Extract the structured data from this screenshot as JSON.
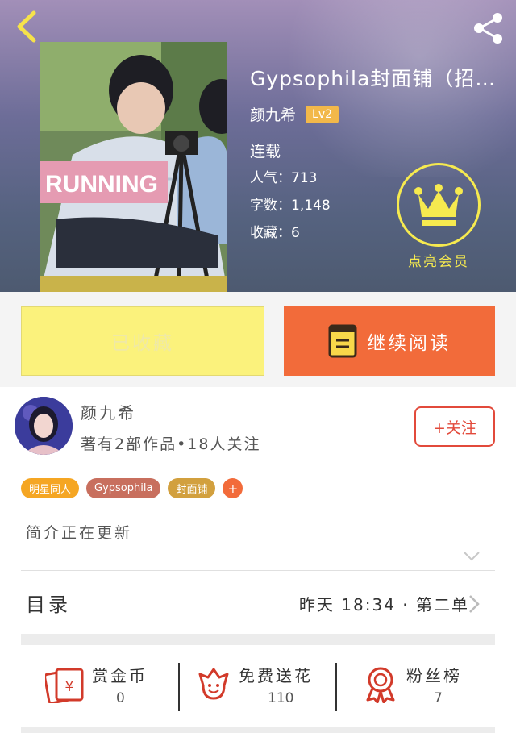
{
  "header": {
    "back_icon": "chevron-left-icon",
    "share_icon": "share-icon",
    "cover_text": "RUNNING",
    "title": "Gypsophila封面铺（招…",
    "author": "颜九希",
    "level": "Lv2",
    "status": "连载",
    "stats": [
      {
        "label": "人气：",
        "value": "713"
      },
      {
        "label": "字数：",
        "value": "1,148"
      },
      {
        "label": "收藏：",
        "value": "6"
      }
    ],
    "vip_icon": "crown-icon",
    "vip_label": "点亮会员"
  },
  "actions": {
    "collect_label": "已收藏",
    "read_label": "继续阅读",
    "read_icon": "book-icon"
  },
  "author_section": {
    "name": "颜九希",
    "works": "著有2部作品•18人关注",
    "follow_label": "+关注"
  },
  "tags": [
    {
      "label": "明星同人",
      "color": "#f5a623"
    },
    {
      "label": "Gypsophila",
      "color": "#c86f5e"
    },
    {
      "label": "封面铺",
      "color": "#d2a03e"
    }
  ],
  "tag_add": "+",
  "intro": "简介正在更新",
  "catalog": {
    "title": "目录",
    "update": "昨天 18:34 · 第二单"
  },
  "bottom": [
    {
      "label": "赏金币",
      "value": "0",
      "icon": "red-envelope-icon"
    },
    {
      "label": "免费送花",
      "value": "110",
      "icon": "flower-icon"
    },
    {
      "label": "粉丝榜",
      "value": "7",
      "icon": "medal-icon"
    }
  ],
  "colors": {
    "accent": "#f26b3a",
    "follow": "#e24a3b",
    "collect_bg": "#fbf27c",
    "vip": "#f6ea4f"
  }
}
